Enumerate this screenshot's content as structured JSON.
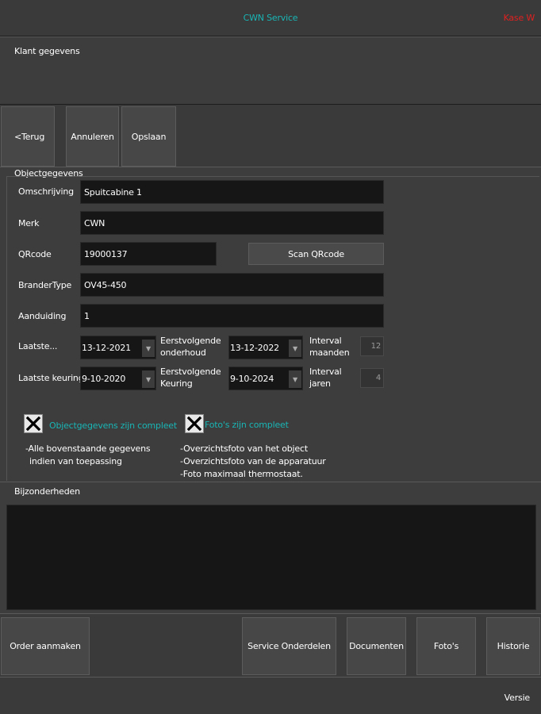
{
  "header": {
    "title": "CWN Service",
    "status": "Kase W"
  },
  "klant": {
    "section_label": "Klant gegevens"
  },
  "nav": {
    "back_label": "<Terug",
    "cancel_label": "Annuleren",
    "save_label": "Opslaan"
  },
  "object": {
    "section_label": "Objectgegevens",
    "omschrijving": {
      "label": "Omschrijving",
      "value": "Spuitcabine 1"
    },
    "merk": {
      "label": "Merk",
      "value": "CWN"
    },
    "qrcode": {
      "label": "QRcode",
      "value": "19000137",
      "scan_label": "Scan QRcode"
    },
    "brandertype": {
      "label": "BranderType",
      "value": "OV45-450"
    },
    "aanduiding": {
      "label": "Aanduiding",
      "value": "1"
    },
    "laatste_onderhoud": {
      "label": "Laatste...",
      "date": "13-12-2021",
      "next_label_1": "Eerstvolgende",
      "next_label_2": "onderhoud",
      "next_date": "13-12-2022",
      "interval_label_1": "Interval",
      "interval_label_2": "maanden",
      "interval_value": "12"
    },
    "laatste_keuring": {
      "label": "Laatste keuring",
      "date": "9-10-2020",
      "next_label_1": "Eerstvolgende",
      "next_label_2": "Keuring",
      "next_date": "9-10-2024",
      "interval_label_1": "Interval",
      "interval_label_2": "jaren",
      "interval_value": "4"
    },
    "check_object": {
      "label": "Objectgegevens zijn compleet",
      "checked": true
    },
    "check_photos": {
      "label": "Foto's zijn compleet",
      "checked": true
    },
    "note_left_1": "-Alle bovenstaande gegevens",
    "note_left_2": "indien van toepassing",
    "note_right_1": "-Overzichtsfoto van het object",
    "note_right_2": "-Overzichtsfoto van de apparatuur",
    "note_right_3": "-Foto maximaal thermostaat."
  },
  "bijzonderheden": {
    "section_label": "Bijzonderheden",
    "value": ""
  },
  "bottom": {
    "order_label": "Order aanmaken",
    "parts_label": "Service Onderdelen",
    "docs_label": "Documenten",
    "photos_label": "Foto's",
    "history_label": "Historie"
  },
  "footer": {
    "version_label": "Versie"
  },
  "colors": {
    "accent": "#19b5b5",
    "alert": "#e02020",
    "background": "#3a3a3a",
    "field": "#161616"
  }
}
